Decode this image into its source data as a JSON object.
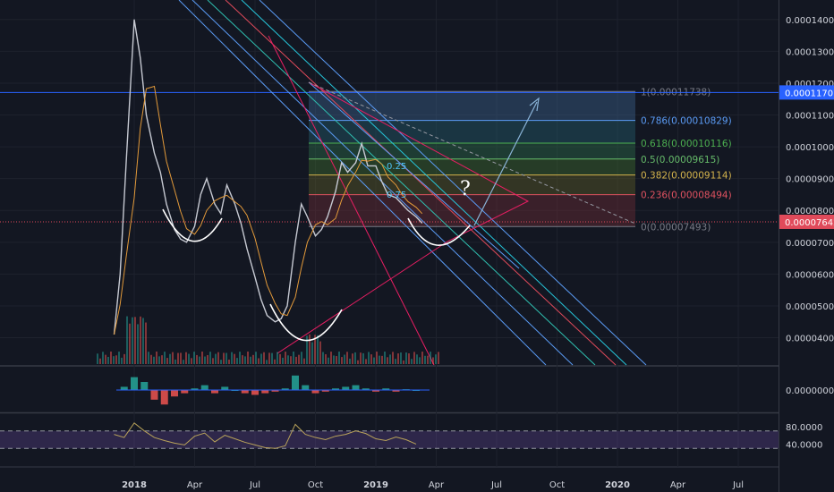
{
  "chart_data": {
    "type": "line",
    "instrument_price_axis": {
      "range": [
        3.2e-05,
        0.000145
      ],
      "ticks": [
        "0.00014000",
        "0.00013000",
        "0.00012000",
        "0.00011000",
        "0.00010000",
        "0.00009000",
        "0.00008000",
        "0.00007000",
        "0.00006000",
        "0.00005000",
        "0.00004000"
      ],
      "tick_values": [
        0.00014,
        0.00013,
        0.00012,
        0.00011,
        0.0001,
        9e-05,
        8e-05,
        7e-05,
        6e-05,
        5e-05,
        4e-05
      ]
    },
    "time_axis": {
      "labels": [
        "2018",
        "Apr",
        "Jul",
        "Oct",
        "2019",
        "Apr",
        "Jul",
        "Oct",
        "2020",
        "Apr",
        "Jul"
      ],
      "months_from_dec_2017": [
        1,
        4,
        7,
        10,
        13,
        16,
        19,
        22,
        25,
        28,
        31
      ]
    },
    "price_series": {
      "month_index": [
        0.0,
        0.3,
        0.6,
        1.0,
        1.3,
        1.6,
        2.0,
        2.3,
        2.6,
        3.0,
        3.3,
        3.6,
        4.0,
        4.3,
        4.6,
        5.0,
        5.3,
        5.6,
        6.0,
        6.3,
        6.6,
        7.0,
        7.3,
        7.6,
        8.0,
        8.3,
        8.6,
        9.0,
        9.3,
        9.6,
        10.0,
        10.3,
        10.6,
        11.0,
        11.3,
        11.6,
        12.0,
        12.3,
        12.6,
        13.0,
        13.3,
        13.6,
        14.0,
        14.3,
        14.6,
        15.0,
        15.3
      ],
      "close": [
        4.1e-05,
        6e-05,
        9.5e-05,
        0.00014,
        0.000128,
        0.00011,
        9.8e-05,
        9.2e-05,
        8.2e-05,
        7.4e-05,
        7.1e-05,
        7e-05,
        7.5e-05,
        8.5e-05,
        9e-05,
        8.2e-05,
        7.9e-05,
        8.8e-05,
        8.2e-05,
        7.6e-05,
        6.8e-05,
        5.9e-05,
        5.2e-05,
        4.7e-05,
        4.5e-05,
        4.6e-05,
        5e-05,
        7e-05,
        8.2e-05,
        7.8e-05,
        7.2e-05,
        7.4e-05,
        7.8e-05,
        8.6e-05,
        9.5e-05,
        9.2e-05,
        9.5e-05,
        0.000101,
        9.4e-05,
        9.4e-05,
        8.9e-05,
        8.5e-05,
        8.4e-05,
        8.2e-05,
        8e-05,
        7.8e-05,
        7.6e-05
      ]
    },
    "last_price": "0.00007642",
    "crosshair_price": "0.00011707",
    "fib_levels": [
      {
        "label": "1(0.00011738)",
        "value": 0.00011738,
        "color": "#787b86"
      },
      {
        "label": "0.786(0.00010829)",
        "value": 0.00010829,
        "color": "#5b9cf6"
      },
      {
        "label": "0.618(0.00010116)",
        "value": 0.00010116,
        "color": "#4caf50"
      },
      {
        "label": "0.5(0.00009615)",
        "value": 9.615e-05,
        "color": "#66bb6a"
      },
      {
        "label": "0.382(0.00009114)",
        "value": 9.114e-05,
        "color": "#d4b34c"
      },
      {
        "label": "0.236(0.00008494)",
        "value": 8.494e-05,
        "color": "#e05260"
      },
      {
        "label": "0(0.00007493)",
        "value": 7.493e-05,
        "color": "#787b86"
      }
    ],
    "annotations": [
      "0.25",
      "0.75",
      "?"
    ],
    "macd": {
      "zero_label": "0.00000000",
      "month_index": [
        0.5,
        1.0,
        1.5,
        2.0,
        2.5,
        3.0,
        3.5,
        4.0,
        4.5,
        5.0,
        5.5,
        6.0,
        6.5,
        7.0,
        7.5,
        8.0,
        8.5,
        9.0,
        9.5,
        10.0,
        10.5,
        11.0,
        11.5,
        12.0,
        12.5,
        13.0,
        13.5,
        14.0,
        14.5,
        15.0
      ],
      "hist": [
        0.2,
        0.8,
        0.5,
        -0.6,
        -0.9,
        -0.4,
        -0.2,
        0.1,
        0.3,
        -0.2,
        0.2,
        0.0,
        -0.2,
        -0.3,
        -0.2,
        -0.1,
        0.1,
        0.9,
        0.3,
        -0.2,
        -0.1,
        0.1,
        0.2,
        0.3,
        0.1,
        -0.1,
        0.1,
        -0.1,
        0.05,
        0.0
      ]
    },
    "rsi": {
      "ticks": [
        "80.0000",
        "40.0000"
      ],
      "tick_values": [
        80,
        40
      ],
      "band": [
        70,
        30
      ],
      "month_index": [
        0.0,
        0.5,
        1.0,
        1.5,
        2.0,
        2.5,
        3.0,
        3.5,
        4.0,
        4.5,
        5.0,
        5.5,
        6.0,
        6.5,
        7.0,
        7.5,
        8.0,
        8.5,
        9.0,
        9.5,
        10.0,
        10.5,
        11.0,
        11.5,
        12.0,
        12.5,
        13.0,
        13.5,
        14.0,
        14.5,
        15.0
      ],
      "values": [
        62,
        55,
        88,
        70,
        55,
        48,
        42,
        38,
        58,
        65,
        45,
        60,
        52,
        44,
        38,
        32,
        30,
        36,
        85,
        62,
        55,
        50,
        58,
        62,
        70,
        64,
        52,
        48,
        56,
        50,
        40
      ]
    }
  }
}
